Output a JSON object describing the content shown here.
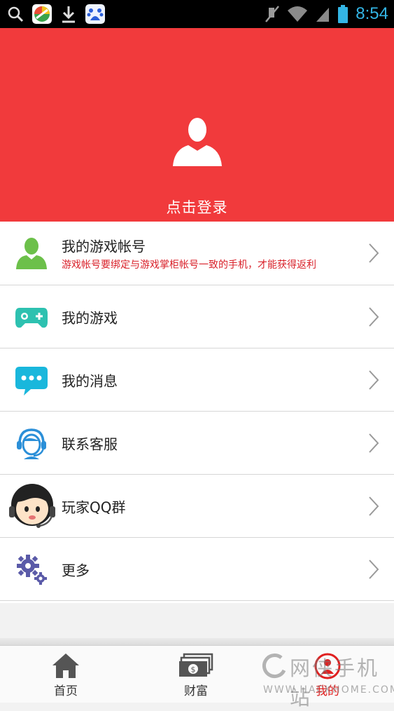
{
  "status_bar": {
    "time": "8:54",
    "icons": [
      "search-icon",
      "app-store-icon",
      "download-icon",
      "baidu-icon",
      "mute-icon",
      "wifi-icon",
      "signal-icon",
      "battery-icon"
    ]
  },
  "header": {
    "login_label": "点击登录",
    "background_color": "#f13a3c"
  },
  "menu": {
    "items": [
      {
        "label": "我的游戏帐号",
        "sublabel": "游戏帐号要绑定与游戏掌柜帐号一致的手机，才能获得返利",
        "icon": "user-icon"
      },
      {
        "label": "我的游戏",
        "icon": "gamepad-icon"
      },
      {
        "label": "我的消息",
        "icon": "chat-bubble-icon"
      },
      {
        "label": "联系客服",
        "icon": "customer-service-icon"
      },
      {
        "label": "玩家QQ群",
        "icon": "qq-group-icon"
      },
      {
        "label": "更多",
        "icon": "gear-icon"
      }
    ]
  },
  "bottom_nav": {
    "tabs": [
      {
        "label": "首页",
        "icon": "home-icon"
      },
      {
        "label": "财富",
        "icon": "money-icon"
      },
      {
        "label": "我的",
        "icon": "profile-icon",
        "active": true
      }
    ]
  },
  "watermark": {
    "text": "网侠手机站",
    "url": "WWW.HACKHOME.COM"
  }
}
